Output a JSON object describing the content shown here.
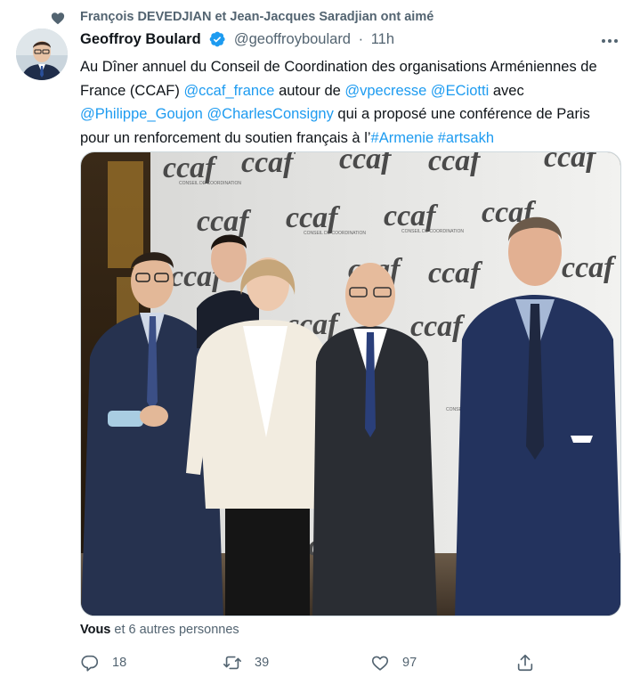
{
  "social_context": {
    "icon": "heart-icon",
    "text": "François DEVEDJIAN et Jean-Jacques Saradjian ont aimé"
  },
  "author": {
    "name": "Geoffroy Boulard",
    "handle": "@geoffroyboulard",
    "separator": "·",
    "time": "11h",
    "verified_icon": "verified-badge-icon",
    "verified_color": "#1d9bf0"
  },
  "tweet": {
    "segments": [
      {
        "text": "Au Dîner annuel du Conseil de Coordination des organisations Arméniennes de France (CCAF) ",
        "link": false
      },
      {
        "text": "@ccaf_france",
        "link": true
      },
      {
        "text": " autour de ",
        "link": false
      },
      {
        "text": "@vpecresse",
        "link": true
      },
      {
        "text": " ",
        "link": false
      },
      {
        "text": "@ECiotti",
        "link": true
      },
      {
        "text": " avec ",
        "link": false
      },
      {
        "text": "@Philippe_Goujon",
        "link": true
      },
      {
        "text": " ",
        "link": false
      },
      {
        "text": "@CharlesConsigny",
        "link": true
      },
      {
        "text": " qui a proposé une conférence de Paris pour un renforcement du soutien français à l’",
        "link": false
      },
      {
        "text": "#Armenie",
        "link": true
      },
      {
        "text": " ",
        "link": false
      },
      {
        "text": "#artsakh",
        "link": true
      }
    ],
    "link_color": "#1d9bf0"
  },
  "media": {
    "backdrop_logo": "ccaf",
    "backdrop_subtitle": "CONSEIL DE COORDINATION DES ORGANISATIONS ARMÉNIENNES DE FRANCE"
  },
  "likes_line": {
    "bold": "Vous",
    "rest": " et 6 autres personnes"
  },
  "actions": {
    "reply": {
      "icon": "reply-icon",
      "count": "18"
    },
    "retweet": {
      "icon": "retweet-icon",
      "count": "39"
    },
    "like": {
      "icon": "heart-outline-icon",
      "count": "97"
    },
    "share": {
      "icon": "share-icon"
    }
  },
  "colors": {
    "text_primary": "#0f1419",
    "text_secondary": "#536471",
    "accent": "#1d9bf0"
  }
}
